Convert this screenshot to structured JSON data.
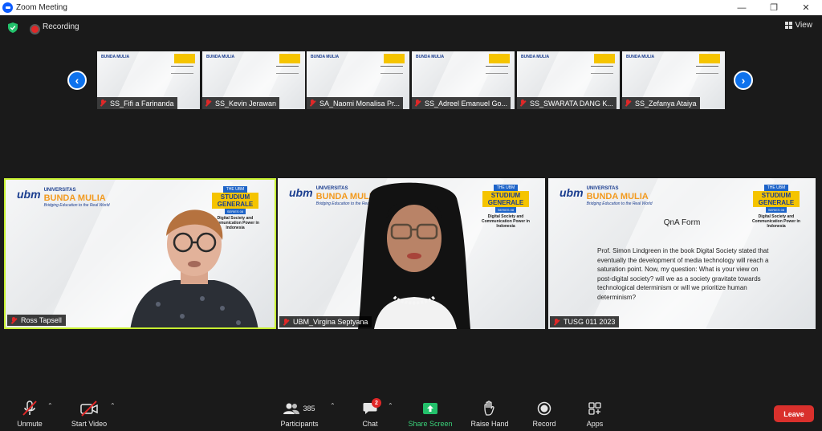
{
  "window": {
    "title": "Zoom Meeting"
  },
  "status": {
    "recording_label": "Recording",
    "view_label": "View"
  },
  "strip": {
    "thumbnails": [
      {
        "name": "SS_Fifi a Farinanda"
      },
      {
        "name": "SS_Kevin Jerawan"
      },
      {
        "name": "SA_Naomi Monalisa Pr..."
      },
      {
        "name": "SS_Adreel Emanuel Go..."
      },
      {
        "name": "SS_SWARATA DANG K..."
      },
      {
        "name": "SS_Zefanya Ataiya"
      }
    ]
  },
  "slide": {
    "ubm_mark": "ubm",
    "university": "UNIVERSITAS",
    "name": "BUNDA MULIA",
    "tagline": "Bridging Education to the Real World",
    "badge_top": "THE UBM",
    "badge_main": "STUDIUM GENERALE",
    "badge_series": "SERIES 08",
    "topic": "Digital Society and Communication Power in Indonesia"
  },
  "tiles": [
    {
      "name": "Ross Tapsell"
    },
    {
      "name": "UBM_Virgina Septyana"
    },
    {
      "name": "TUSG 011 2023"
    }
  ],
  "qna": {
    "title": "QnA Form",
    "body": "Prof. Simon Lindgreen in the book Digital Society stated that eventually the development of media technology will reach a saturation point. Now, my question: What is your view on post-digital society? will we as a society gravitate towards technological determinism or will we prioritize human determinism?"
  },
  "toolbar": {
    "unmute": "Unmute",
    "start_video": "Start Video",
    "participants": "Participants",
    "participants_count": "385",
    "chat": "Chat",
    "chat_badge": "2",
    "share_screen": "Share Screen",
    "raise_hand": "Raise Hand",
    "record": "Record",
    "apps": "Apps",
    "leave": "Leave"
  },
  "colors": {
    "accent_blue": "#0e72ed",
    "leave_red": "#d9302c",
    "share_green": "#3ad27a",
    "active_speaker": "#c7f031"
  }
}
